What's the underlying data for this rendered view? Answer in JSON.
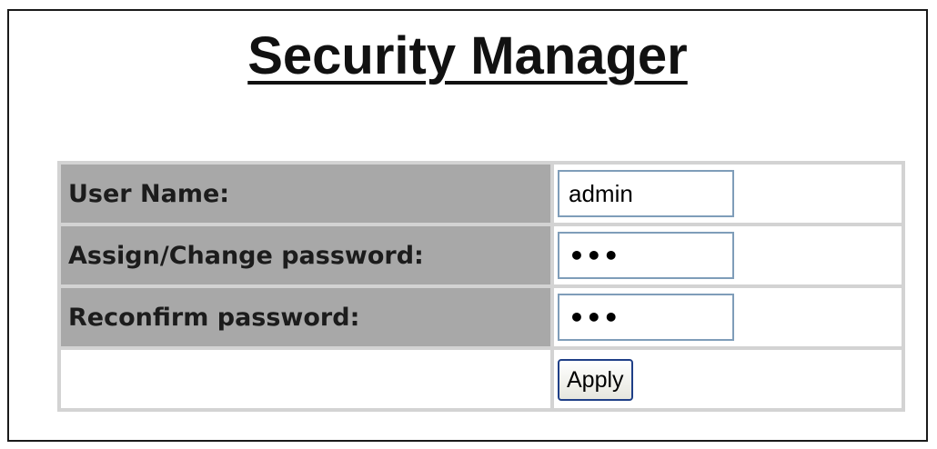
{
  "page": {
    "title": "Security Manager"
  },
  "form": {
    "rows": [
      {
        "label": "User Name:",
        "value": "admin",
        "type": "text"
      },
      {
        "label": "Assign/Change password:",
        "value": "•••",
        "type": "password"
      },
      {
        "label": "Reconfirm password:",
        "value": "•••",
        "type": "password"
      }
    ],
    "apply_label": "Apply"
  },
  "colors": {
    "label_bg": "#a8a8a8",
    "grid_border": "#d3d3d3",
    "input_border": "#7f9db9",
    "button_border": "#1f3f87"
  }
}
